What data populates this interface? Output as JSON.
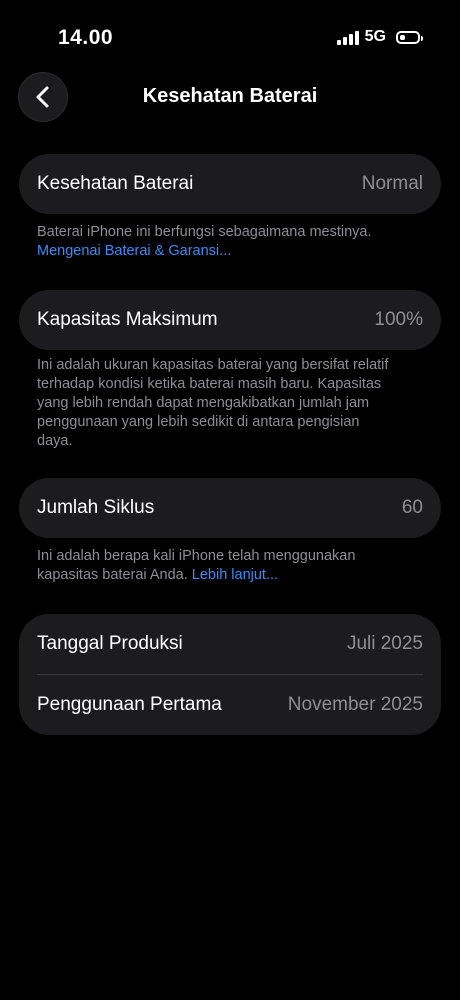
{
  "status_bar": {
    "time": "14.00",
    "network": "5G",
    "signal_level": 4,
    "battery_level": 0.3
  },
  "nav": {
    "title": "Kesehatan Baterai",
    "back_icon": "chevron-left-icon"
  },
  "battery_health": {
    "label": "Kesehatan Baterai",
    "value": "Normal",
    "footnote": "Baterai iPhone ini berfungsi sebagaimana mestinya.",
    "link": "Mengenai Baterai & Garansi..."
  },
  "max_capacity": {
    "label": "Kapasitas Maksimum",
    "value": "100%",
    "footnote_lines": [
      "Ini adalah ukuran kapasitas baterai yang bersifat relatif",
      "terhadap kondisi ketika baterai masih baru. Kapasitas",
      "yang lebih rendah dapat mengakibatkan jumlah jam",
      "penggunaan yang lebih sedikit di antara pengisian",
      "daya."
    ]
  },
  "cycle_count": {
    "label": "Jumlah Siklus",
    "value": "60",
    "footnote_line1": "Ini adalah berapa kali iPhone telah menggunakan",
    "footnote_line2": "kapasitas baterai Anda. ",
    "link": "Lebih lanjut..."
  },
  "dates": {
    "manufacture_label": "Tanggal Produksi",
    "manufacture_value": "Juli 2025",
    "first_use_label": "Penggunaan Pertama",
    "first_use_value": "November 2025"
  },
  "colors": {
    "background": "#000000",
    "card": "#1c1c1e",
    "secondary_text": "#8e8e93",
    "link": "#3a8bf5"
  }
}
